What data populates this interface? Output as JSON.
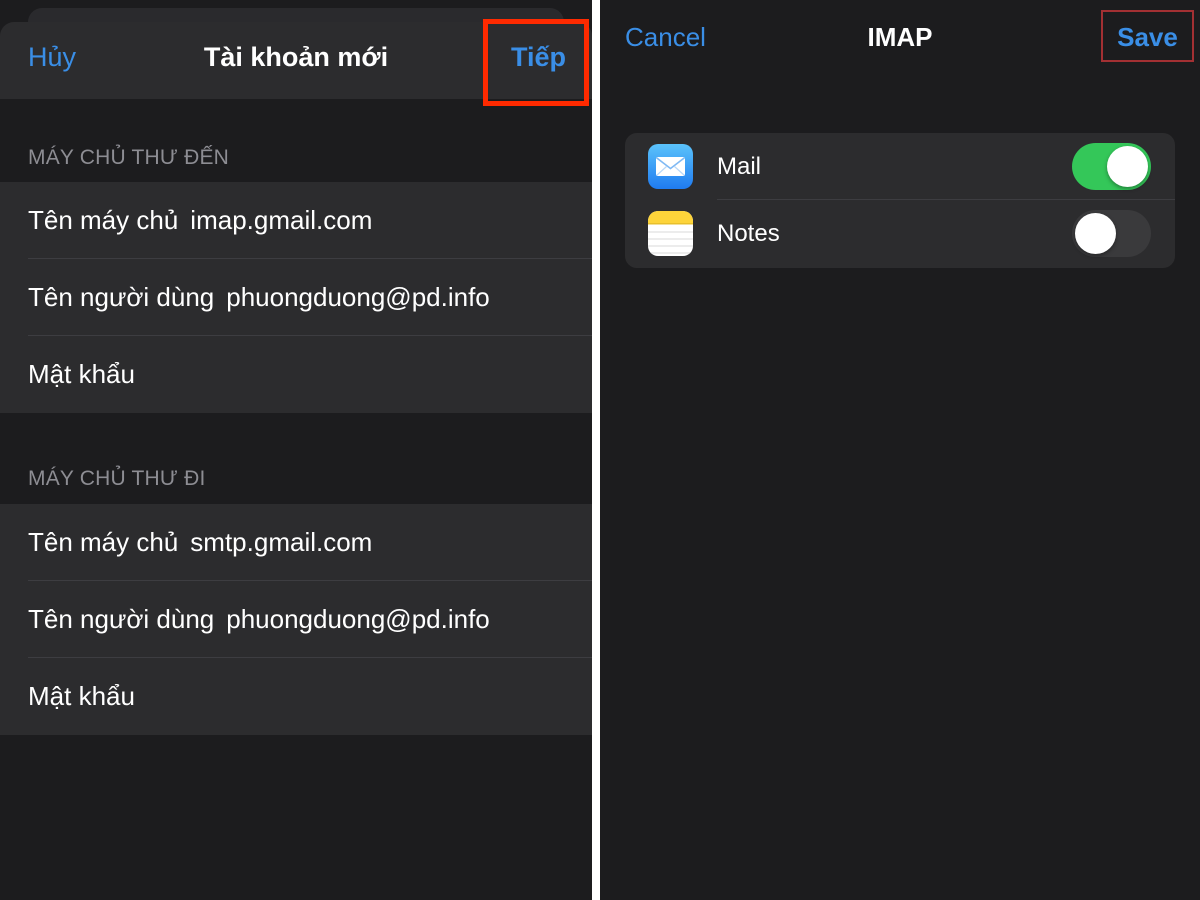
{
  "left": {
    "nav": {
      "cancel": "Hủy",
      "title": "Tài khoản mới",
      "next": "Tiếp"
    },
    "incoming": {
      "header": "MÁY CHỦ THƯ ĐẾN",
      "rows": [
        {
          "label": "Tên máy chủ",
          "value": "imap.gmail.com"
        },
        {
          "label": "Tên người dùng",
          "value": "phuongduong@pd.info"
        },
        {
          "label": "Mật khẩu",
          "value": ""
        }
      ]
    },
    "outgoing": {
      "header": "MÁY CHỦ THƯ ĐI",
      "rows": [
        {
          "label": "Tên máy chủ",
          "value": "smtp.gmail.com"
        },
        {
          "label": "Tên người dùng",
          "value": "phuongduong@pd.info"
        },
        {
          "label": "Mật khẩu",
          "value": ""
        }
      ]
    }
  },
  "right": {
    "nav": {
      "cancel": "Cancel",
      "title": "IMAP",
      "save": "Save"
    },
    "apps": [
      {
        "label": "Mail",
        "icon": "mail-app-icon",
        "enabled": true
      },
      {
        "label": "Notes",
        "icon": "notes-app-icon",
        "enabled": false
      }
    ]
  },
  "colors": {
    "background": "#1c1c1e",
    "cell": "#2c2c2e",
    "accent": "#3a8ee6",
    "toggle_on": "#34c759",
    "highlight_red": "#ff2a00"
  }
}
